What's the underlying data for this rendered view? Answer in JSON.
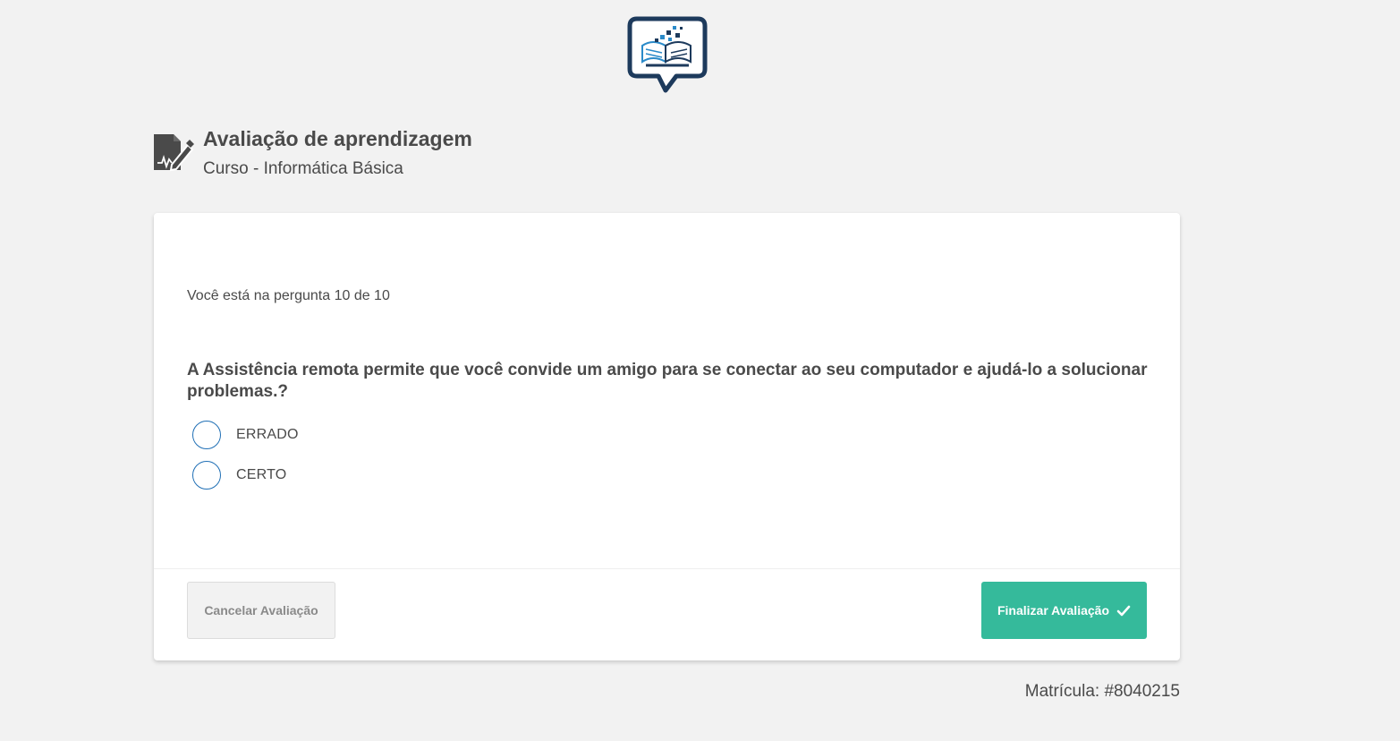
{
  "logo": {
    "icon": "speech-bubble-book-logo",
    "frame_color": "#1d3a5c",
    "accent_color": "#2a8ac9"
  },
  "header": {
    "icon": "exam-edit-icon",
    "title": "Avaliação de aprendizagem",
    "subtitle": "Curso - Informática Básica"
  },
  "quiz": {
    "progress_text": "Você está na pergunta 10 de 10",
    "question": "A Assistência remota permite que você convide um amigo para se conectar ao seu computador e ajudá-lo a solucionar problemas.?",
    "options": [
      {
        "label": "ERRADO",
        "selected": false
      },
      {
        "label": "CERTO",
        "selected": false
      }
    ]
  },
  "actions": {
    "cancel_label": "Cancelar Avaliação",
    "finish_label": "Finalizar Avaliação",
    "finish_icon": "check-icon",
    "finish_color": "#35ba9b"
  },
  "footer": {
    "matricula": "Matrícula: #8040215"
  }
}
